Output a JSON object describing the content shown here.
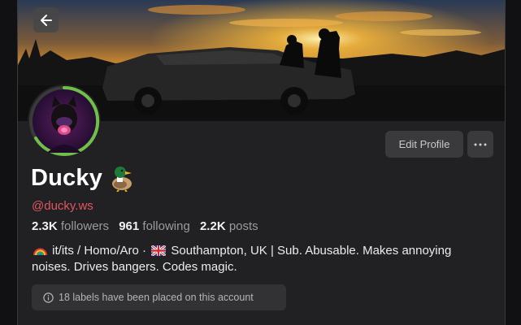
{
  "profile": {
    "display_name": "Ducky",
    "name_emoji": "duck-emoji",
    "handle": "@ducky.ws",
    "stats": {
      "followers_count": "2.3K",
      "followers_label": "followers",
      "following_count": "961",
      "following_label": "following",
      "posts_count": "2.2K",
      "posts_label": "posts"
    },
    "bio_part1": "it/its / Homo/Aro · ",
    "bio_part2": "Southampton, UK | Sub. Abusable. Makes annoying noises. Drives bangers. Codes magic.",
    "labels_notice": "18 labels have been placed on this account"
  },
  "actions": {
    "edit_profile_label": "Edit Profile"
  },
  "icons": {
    "back": "arrow-left-icon",
    "more": "ellipsis-icon",
    "info": "info-icon",
    "rainbow": "rainbow-emoji",
    "flag": "uk-flag-emoji"
  },
  "colors": {
    "handle": "#e2555f",
    "avatar_ring": "#6fbf48",
    "panel_bg": "#212123"
  }
}
